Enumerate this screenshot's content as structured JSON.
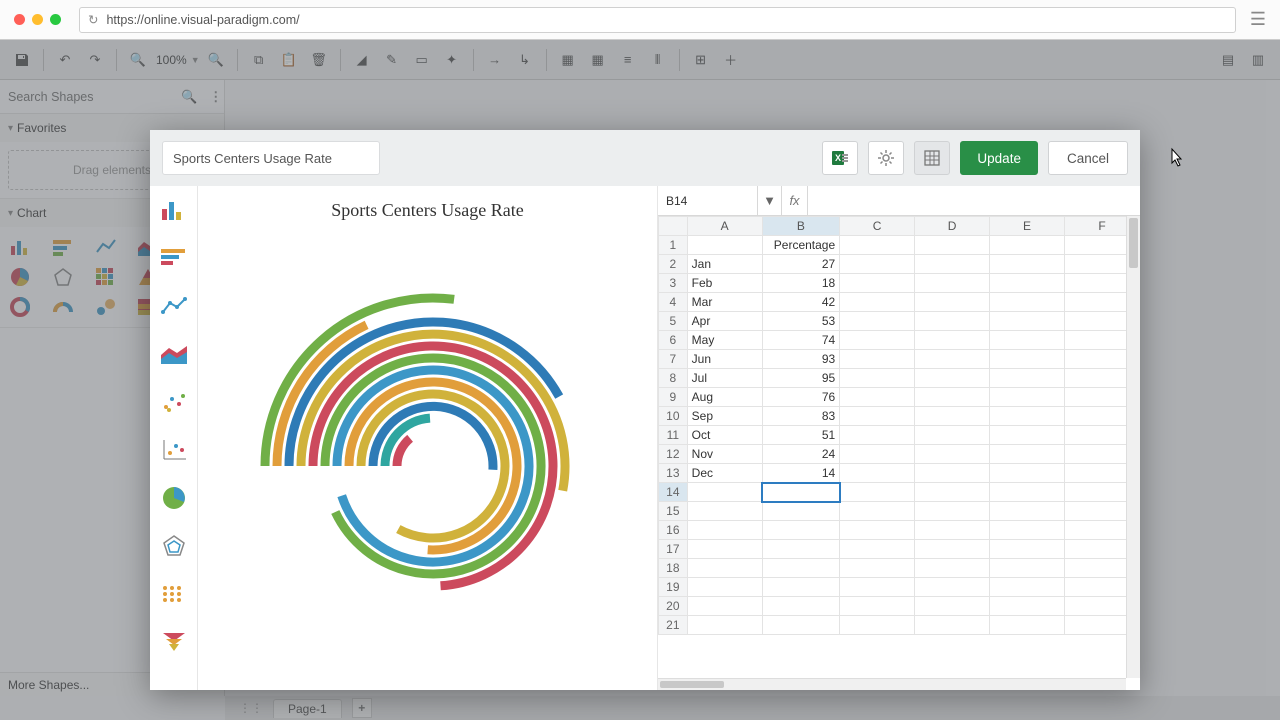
{
  "browser": {
    "url": "https://online.visual-paradigm.com/"
  },
  "toolbar": {
    "zoom": "100%"
  },
  "left_panel": {
    "search_placeholder": "Search Shapes",
    "favorites_label": "Favorites",
    "drag_hint": "Drag elements",
    "chart_label": "Chart",
    "more_shapes": "More Shapes..."
  },
  "page_tabs": {
    "page1": "Page-1"
  },
  "modal": {
    "title_value": "Sports Centers Usage Rate",
    "update_label": "Update",
    "cancel_label": "Cancel"
  },
  "chart_title": "Sports Centers Usage Rate",
  "sheet": {
    "cell_ref": "B14",
    "col_headers": [
      "A",
      "B",
      "C",
      "D",
      "E",
      "F"
    ],
    "header_row": [
      "",
      "Percentage",
      "",
      "",
      "",
      ""
    ],
    "rows": [
      {
        "n": "2",
        "cells": [
          "Jan",
          "27",
          "",
          "",
          "",
          ""
        ]
      },
      {
        "n": "3",
        "cells": [
          "Feb",
          "18",
          "",
          "",
          "",
          ""
        ]
      },
      {
        "n": "4",
        "cells": [
          "Mar",
          "42",
          "",
          "",
          "",
          ""
        ]
      },
      {
        "n": "5",
        "cells": [
          "Apr",
          "53",
          "",
          "",
          "",
          ""
        ]
      },
      {
        "n": "6",
        "cells": [
          "May",
          "74",
          "",
          "",
          "",
          ""
        ]
      },
      {
        "n": "7",
        "cells": [
          "Jun",
          "93",
          "",
          "",
          "",
          ""
        ]
      },
      {
        "n": "8",
        "cells": [
          "Jul",
          "95",
          "",
          "",
          "",
          ""
        ]
      },
      {
        "n": "9",
        "cells": [
          "Aug",
          "76",
          "",
          "",
          "",
          ""
        ]
      },
      {
        "n": "10",
        "cells": [
          "Sep",
          "83",
          "",
          "",
          "",
          ""
        ]
      },
      {
        "n": "11",
        "cells": [
          "Oct",
          "51",
          "",
          "",
          "",
          ""
        ]
      },
      {
        "n": "12",
        "cells": [
          "Nov",
          "24",
          "",
          "",
          "",
          ""
        ]
      },
      {
        "n": "13",
        "cells": [
          "Dec",
          "14",
          "",
          "",
          "",
          ""
        ]
      },
      {
        "n": "14",
        "cells": [
          "",
          "",
          "",
          "",
          "",
          ""
        ]
      },
      {
        "n": "15",
        "cells": [
          "",
          "",
          "",
          "",
          "",
          ""
        ]
      },
      {
        "n": "16",
        "cells": [
          "",
          "",
          "",
          "",
          "",
          ""
        ]
      },
      {
        "n": "17",
        "cells": [
          "",
          "",
          "",
          "",
          "",
          ""
        ]
      },
      {
        "n": "18",
        "cells": [
          "",
          "",
          "",
          "",
          "",
          ""
        ]
      },
      {
        "n": "19",
        "cells": [
          "",
          "",
          "",
          "",
          "",
          ""
        ]
      },
      {
        "n": "20",
        "cells": [
          "",
          "",
          "",
          "",
          "",
          ""
        ]
      },
      {
        "n": "21",
        "cells": [
          "",
          "",
          "",
          "",
          "",
          ""
        ]
      }
    ]
  },
  "chart_data": {
    "type": "bar",
    "title": "Sports Centers Usage Rate",
    "xlabel": "",
    "ylabel": "Percentage",
    "ylim": [
      0,
      100
    ],
    "categories": [
      "Jan",
      "Feb",
      "Mar",
      "Apr",
      "May",
      "Jun",
      "Jul",
      "Aug",
      "Sep",
      "Oct",
      "Nov",
      "Dec"
    ],
    "values": [
      27,
      18,
      42,
      53,
      74,
      93,
      95,
      76,
      83,
      51,
      24,
      14
    ],
    "colors": [
      "#70af47",
      "#e19e3b",
      "#2e7bb6",
      "#d0b23b",
      "#cc4a5d",
      "#70af47",
      "#3c97c7",
      "#e19e3b",
      "#d0b23b",
      "#2e7bb6",
      "#2fa6a0",
      "#cc4a5d"
    ]
  }
}
